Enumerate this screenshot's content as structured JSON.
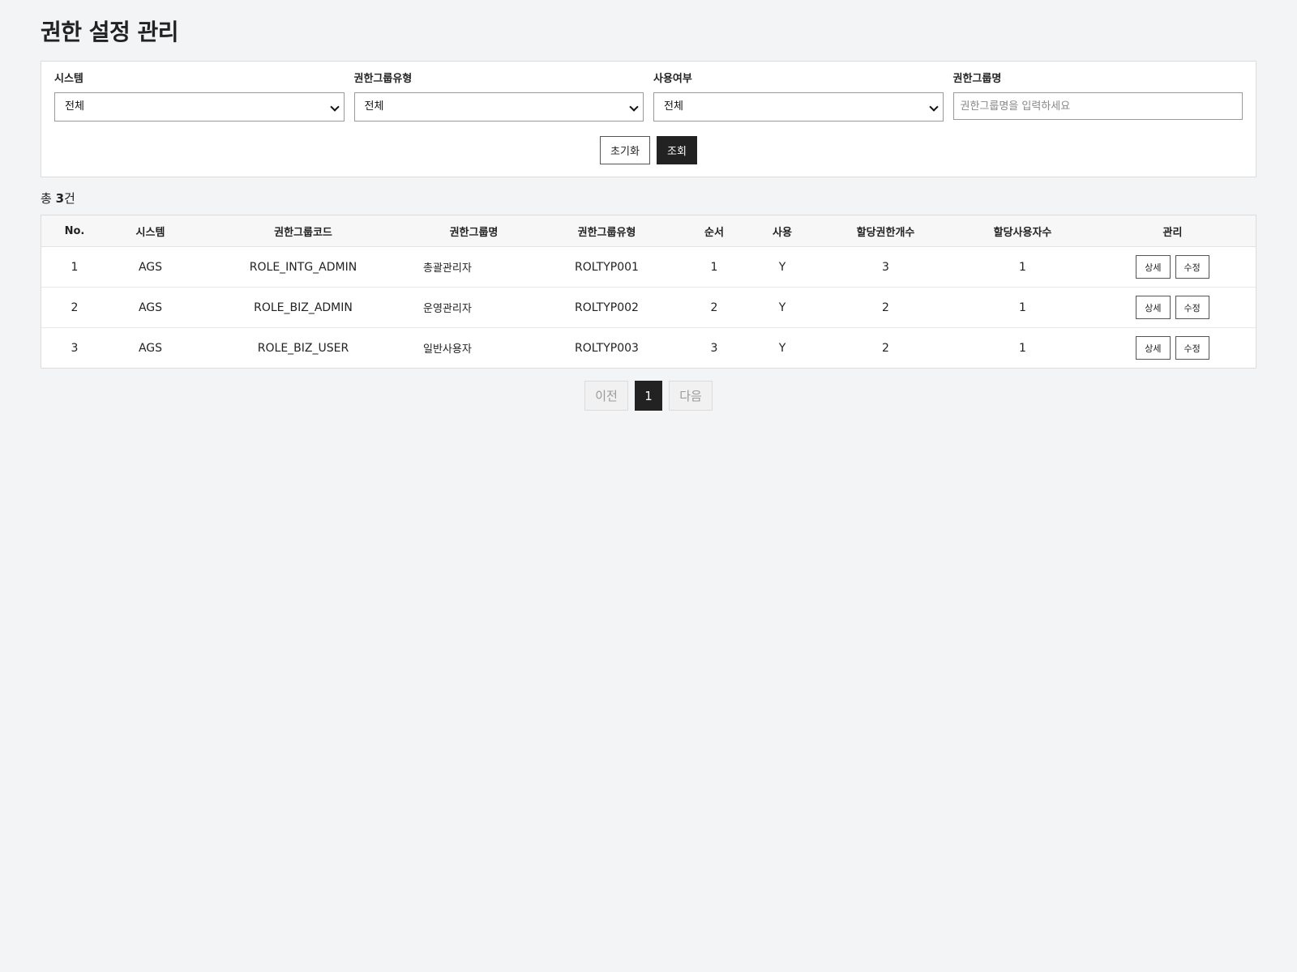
{
  "header": {
    "title": "권한 설정 관리"
  },
  "filters": {
    "system": {
      "label": "시스템",
      "value": "전체"
    },
    "role_group_type": {
      "label": "권한그룹유형",
      "value": "전체"
    },
    "use_yn": {
      "label": "사용여부",
      "value": "전체"
    },
    "role_group_name": {
      "label": "권한그룹명",
      "value": "",
      "placeholder": "권한그룹명을 입력하세요"
    },
    "reset_label": "초기화",
    "search_label": "조회"
  },
  "summary": {
    "prefix": "총 ",
    "count": "3",
    "suffix": "건"
  },
  "table": {
    "headers": [
      "No.",
      "시스템",
      "권한그룹코드",
      "권한그룹명",
      "권한그룹유형",
      "순서",
      "사용",
      "할당권한개수",
      "할당사용자수",
      "관리"
    ],
    "rows": [
      {
        "no": "1",
        "system": "AGS",
        "code": "ROLE_INTG_ADMIN",
        "name": "총괄관리자",
        "type": "ROLTYP001",
        "order": "1",
        "use": "Y",
        "perm_count": "3",
        "user_count": "1",
        "detail_label": "상세",
        "edit_label": "수정"
      },
      {
        "no": "2",
        "system": "AGS",
        "code": "ROLE_BIZ_ADMIN",
        "name": "운영관리자",
        "type": "ROLTYP002",
        "order": "2",
        "use": "Y",
        "perm_count": "2",
        "user_count": "1",
        "detail_label": "상세",
        "edit_label": "수정"
      },
      {
        "no": "3",
        "system": "AGS",
        "code": "ROLE_BIZ_USER",
        "name": "일반사용자",
        "type": "ROLTYP003",
        "order": "3",
        "use": "Y",
        "perm_count": "2",
        "user_count": "1",
        "detail_label": "상세",
        "edit_label": "수정"
      }
    ]
  },
  "pagination": {
    "prev_label": "이전",
    "current_page": "1",
    "next_label": "다음"
  }
}
